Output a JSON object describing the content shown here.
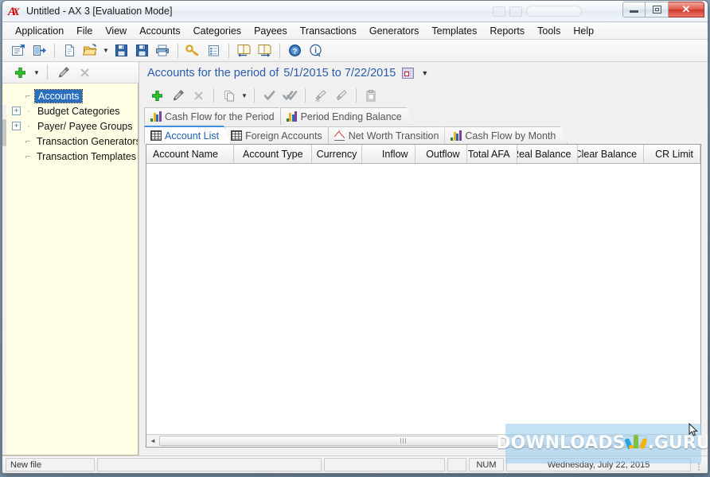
{
  "window": {
    "title": "Untitled - AX 3 [Evaluation Mode]",
    "logo_text": "A",
    "logo_text2": "X",
    "minimize_label": "Minimize",
    "maximize_label": "Maximize",
    "close_label": "✕"
  },
  "menubar": {
    "items": [
      {
        "label": "Application"
      },
      {
        "label": "File"
      },
      {
        "label": "View"
      },
      {
        "label": "Accounts"
      },
      {
        "label": "Categories"
      },
      {
        "label": "Payees"
      },
      {
        "label": "Transactions"
      },
      {
        "label": "Generators"
      },
      {
        "label": "Templates"
      },
      {
        "label": "Reports"
      },
      {
        "label": "Tools"
      },
      {
        "label": "Help"
      }
    ]
  },
  "toolbar": {
    "buttons": [
      {
        "icon": "properties-icon",
        "title": "Properties"
      },
      {
        "icon": "exit-icon",
        "title": "Exit"
      },
      {
        "icon": "new-file-icon",
        "title": "New"
      },
      {
        "icon": "open-folder-icon",
        "title": "Open"
      },
      {
        "icon": "open-dropdown-caret-icon",
        "title": "Open recent"
      },
      {
        "icon": "save-icon",
        "title": "Save"
      },
      {
        "icon": "save-as-icon",
        "title": "Save As"
      },
      {
        "icon": "print-icon",
        "title": "Print"
      },
      {
        "icon": "key-icon",
        "title": "Password"
      },
      {
        "icon": "clipboard-list-icon",
        "title": "Register"
      },
      {
        "icon": "import-icon",
        "title": "Import"
      },
      {
        "icon": "export-icon",
        "title": "Export"
      },
      {
        "icon": "help-icon",
        "title": "Help"
      },
      {
        "icon": "info-icon",
        "title": "About"
      }
    ]
  },
  "sidebar": {
    "toolbar": [
      {
        "icon": "add-plus-icon",
        "title": "New"
      },
      {
        "icon": "add-dropdown-caret-icon",
        "title": "New type"
      },
      {
        "icon": "edit-pencil-icon",
        "title": "Edit"
      },
      {
        "icon": "delete-x-icon",
        "title": "Delete"
      }
    ],
    "items": [
      {
        "label": "Accounts",
        "selected": true,
        "expander": "none"
      },
      {
        "label": "Budget Categories",
        "selected": false,
        "expander": "plus"
      },
      {
        "label": "Payer/ Payee Groups",
        "selected": false,
        "expander": "plus"
      },
      {
        "label": "Transaction Generators",
        "selected": false,
        "expander": "none"
      },
      {
        "label": "Transaction Templates",
        "selected": false,
        "expander": "none"
      }
    ]
  },
  "main": {
    "period_title": "Accounts for the period of",
    "period_dates": "5/1/2015 to 7/22/2015",
    "period_picker_icon": "calendar-grid-icon",
    "period_caret": "▼",
    "panel_toolbar": [
      {
        "icon": "add-plus-icon",
        "title": "Add account"
      },
      {
        "icon": "edit-pencil-icon",
        "title": "Edit account"
      },
      {
        "icon": "delete-x-icon",
        "title": "Delete account"
      },
      {
        "icon": "copy-icon",
        "title": "Copy"
      },
      {
        "icon": "copy-dropdown-caret-icon",
        "title": "Copy options"
      },
      {
        "icon": "check-icon",
        "title": "Mark cleared"
      },
      {
        "icon": "double-check-icon",
        "title": "Mark all cleared"
      },
      {
        "icon": "brush-dots-icon",
        "title": "Format"
      },
      {
        "icon": "brush-icon",
        "title": "Apply format"
      },
      {
        "icon": "paste-icon",
        "title": "Paste"
      }
    ],
    "tabs_top": [
      {
        "label": "Cash Flow for the Period",
        "icon": "bar-chart-icon",
        "active": false
      },
      {
        "label": "Period Ending Balance",
        "icon": "bar-chart-icon",
        "active": false
      }
    ],
    "tabs_bottom": [
      {
        "label": "Account List",
        "icon": "grid-table-icon",
        "active": true
      },
      {
        "label": "Foreign Accounts",
        "icon": "grid-table-icon",
        "active": false
      },
      {
        "label": "Net Worth Transition",
        "icon": "line-chart-icon",
        "active": false
      },
      {
        "label": "Cash Flow by Month",
        "icon": "bar-chart-icon",
        "active": false
      }
    ],
    "table": {
      "columns": [
        {
          "label": "Account Name",
          "align": "left",
          "width": 112
        },
        {
          "label": "Account Type",
          "align": "center",
          "width": 100
        },
        {
          "label": "Currency",
          "align": "center",
          "width": 63
        },
        {
          "label": "Inflow",
          "align": "right",
          "width": 68
        },
        {
          "label": "Outflow",
          "align": "right",
          "width": 66
        },
        {
          "label": "Total AFA",
          "align": "right",
          "width": 64
        },
        {
          "label": "Real Balance",
          "align": "right",
          "width": 78
        },
        {
          "label": "Clear Balance",
          "align": "right",
          "width": 84
        },
        {
          "label": "CR Limit",
          "align": "right",
          "width": 72
        }
      ],
      "rows": []
    },
    "scrollbar": {
      "left_arrow": "◄",
      "grip": "|||"
    }
  },
  "statusbar": {
    "file_status": "New file",
    "message": "",
    "secondary": "",
    "indicator": "",
    "num_lock": "NUM",
    "date": "Wednesday, July 22, 2015"
  },
  "watermark": {
    "text_left": "DOWNLOADS",
    "text_right": ".GURU",
    "logo": "download-arrow-logo"
  },
  "colors": {
    "accent_blue": "#2b5ca6",
    "tab_active_border": "#3d8ee0",
    "selection_blue": "#2a6ec0",
    "tree_background": "#ffffe6",
    "close_button_red": "#cf3b2c"
  }
}
